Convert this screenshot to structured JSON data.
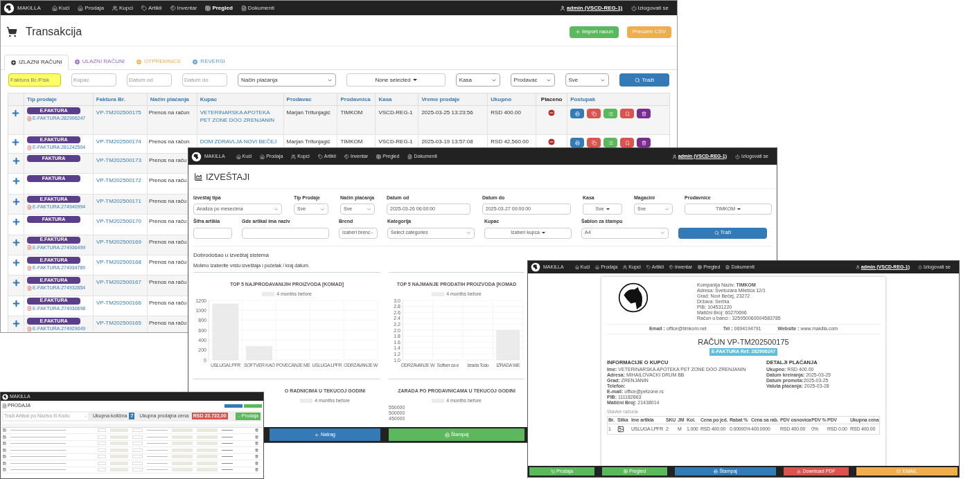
{
  "main_window": {
    "brand": "MAKILLA",
    "nav": [
      {
        "label": "Kući",
        "selected": false
      },
      {
        "label": "Prodaja",
        "selected": false
      },
      {
        "label": "Kupci",
        "selected": false
      },
      {
        "label": "Artikli",
        "selected": false
      },
      {
        "label": "Inventar",
        "selected": false
      },
      {
        "label": "Pregled",
        "selected": true
      },
      {
        "label": "Dokumenti",
        "selected": false
      }
    ],
    "user": "admin (VSCD-REG-1)",
    "logout": "Izlogovati se",
    "title": "Transakcija",
    "actions": [
      {
        "label": "Import racun",
        "kind": "success"
      },
      {
        "label": "Preuzmi CSV",
        "kind": "warning"
      }
    ],
    "tabs": [
      {
        "label": "IZLAZNI RAČUNI",
        "selected": true,
        "color": "#333333"
      },
      {
        "label": "ULAZNI RAČUNI",
        "selected": false,
        "color": "#8e6bbf"
      },
      {
        "label": "OTPREMNICE",
        "selected": false,
        "color": "#f0ad4e"
      },
      {
        "label": "REVERSI",
        "selected": false,
        "color": "#5b9bd5"
      }
    ],
    "filters": [
      {
        "kind": "input",
        "placeholder": "Faktura Br./Fisk",
        "highlighted": true
      },
      {
        "kind": "input",
        "placeholder": "Kupac",
        "highlighted": false
      },
      {
        "kind": "input",
        "placeholder": "Datum od",
        "highlighted": false
      },
      {
        "kind": "input",
        "placeholder": "Datum do",
        "highlighted": false
      },
      {
        "kind": "select",
        "value": "Način plaćanja"
      },
      {
        "kind": "dropdown",
        "value": "None selected"
      },
      {
        "kind": "select",
        "value": "Kasa"
      },
      {
        "kind": "select",
        "value": "Prodavac"
      },
      {
        "kind": "select",
        "value": "Sve"
      },
      {
        "kind": "button",
        "label": "Traži"
      }
    ],
    "table": {
      "columns": [
        "Tip prodaje",
        "Faktura Br.",
        "Način plaćanja",
        "Kupac",
        "Prodavac",
        "Prodavnica",
        "Kasa",
        "Vreme prodaje",
        "Ukupno",
        "Placeno",
        "Postupak"
      ],
      "rows": [
        {
          "tip": "E.FAKTURA",
          "efaktura": "E-FAKTURA:282906247",
          "faktura": "VP-TM202500175",
          "nacin": "Prenos na račun",
          "kupac": "VETERINARSKA APOTEKA PET ZONE DOO ZRENJANIN",
          "prodavac": "Marjan Trifunjagić",
          "prodavnica": "TIMKOM",
          "kasa": "VSCD-REG-1",
          "vreme": "2025-03-25 13:23:56",
          "ukupno": "RSD 400.00",
          "paid": false
        },
        {
          "tip": "E.FAKTURA",
          "efaktura": "E-FAKTURA:281242504",
          "faktura": "VP-TM202500174",
          "nacin": "Prenos na račun",
          "kupac": "DOM ZDRAVLJA NOVI BEČEJ",
          "prodavac": "Marjan Trifunjagić",
          "prodavnica": "TIMKOM",
          "kasa": "VSCD-REG-1",
          "vreme": "2025-03-19 13:57:08",
          "ukupno": "RSD 42,560.00",
          "paid": false
        },
        {
          "tip": "FAKTURA",
          "faktura": "VP-TM202500173",
          "nacin": "Prenos na raču"
        },
        {
          "tip": "FAKTURA",
          "faktura": "VP-TM202500172",
          "nacin": "Prenos na raču"
        },
        {
          "tip": "E.FAKTURA",
          "efaktura": "E-FAKTURA:274940994",
          "faktura": "VP-TM202500171",
          "nacin": "Prenos na raču"
        },
        {
          "tip": "FAKTURA",
          "faktura": "VP-TM202500170",
          "nacin": "Prenos na raču"
        },
        {
          "tip": "E.FAKTURA",
          "efaktura": "E-FAKTURA:274936499",
          "faktura": "VP-TM202500169",
          "nacin": "Prenos na raču"
        },
        {
          "tip": "E.FAKTURA",
          "efaktura": "E-FAKTURA:274934789",
          "faktura": "VP-TM202500168",
          "nacin": "Prenos na raču"
        },
        {
          "tip": "E.FAKTURA",
          "efaktura": "E-FAKTURA:274932854",
          "faktura": "VP-TM202500167",
          "nacin": "Prenos na raču"
        },
        {
          "tip": "E.FAKTURA",
          "efaktura": "E-FAKTURA:274930698",
          "faktura": "VP-TM202500166",
          "nacin": "Prenos na raču"
        },
        {
          "tip": "E.FAKTURA",
          "efaktura": "E-FAKTURA:274929049",
          "faktura": "VP-TM202500165",
          "nacin": "Prenos na raču"
        }
      ]
    }
  },
  "reports_window": {
    "brand": "MAKILLA",
    "nav": [
      {
        "label": "Kući",
        "selected": false
      },
      {
        "label": "Prodaja",
        "selected": false
      },
      {
        "label": "Kupci",
        "selected": false
      },
      {
        "label": "Artikli",
        "selected": false
      },
      {
        "label": "Inventar",
        "selected": false
      },
      {
        "label": "Pregled",
        "selected": false
      },
      {
        "label": "Dokumenti",
        "selected": false
      }
    ],
    "user": "admin (VSCD-REG-1)",
    "logout": "Izlogovati se",
    "title": "IZVEŠTAJI",
    "fields_row_1": [
      {
        "label": "Izveštaj tipa",
        "kind": "select",
        "value": "Analiza po mesecima"
      },
      {
        "label": "Tip Prodaje",
        "kind": "select",
        "value": "Sve"
      },
      {
        "label": "Način plaćanja",
        "kind": "select",
        "value": "Sve"
      },
      {
        "label": "Datum od",
        "kind": "input",
        "value": "2025-03-26 06:00:00"
      },
      {
        "label": "Datum do",
        "kind": "input",
        "value": "2025-03-27 00:00:00"
      },
      {
        "label": "Kasa",
        "kind": "dropdown",
        "value": "Sve"
      },
      {
        "label": "Magacini",
        "kind": "select",
        "value": "Sve"
      },
      {
        "label": "Prodavnice",
        "kind": "dropdown",
        "value": "TIMKOM"
      }
    ],
    "fields_row_2": [
      {
        "label": "Šifra artikla",
        "kind": "input"
      },
      {
        "label": "Gde artikal ima naziv",
        "kind": "input"
      },
      {
        "label": "Brend",
        "kind": "select",
        "value": "Izaberi brenc"
      },
      {
        "label": "Kategorija",
        "kind": "select",
        "value": "Select categories"
      },
      {
        "label": "Kupac",
        "kind": "dropdown",
        "value": "Izaberi kupca"
      },
      {
        "label": "Šablon za štampu",
        "kind": "select",
        "value": "A4"
      }
    ],
    "search_button": "Traži",
    "welcome": "Dobrodošao u izveštaj sistema",
    "instructions": "Molimo izaberite vrstu izveštaja i početak / kraj datum.",
    "charts": [
      {
        "chart_data": {
          "type": "bar",
          "title": "TOP 5 NAJPRODAVANIJIH PROIZVODA [KOMAD]",
          "categories": [
            "USLUGA LPFR",
            "SOFTVER KAO",
            "POVECANJE ME",
            "USLUGA LPFR",
            "ODRZAVANJE W"
          ],
          "series": [
            {
              "name": "4 months before",
              "color": "#ebebeb",
              "values": [
                1130,
                270,
                0,
                0,
                0
              ]
            }
          ],
          "ylim": [
            0,
            1200
          ],
          "yticks": [
            0,
            200,
            400,
            600,
            800,
            1000,
            1200
          ],
          "grid": true
        }
      },
      {
        "chart_data": {
          "type": "bar",
          "title": "TOP 5 NAJMANJE PRODATIH PROIZVODA [KOMAD",
          "categories": [
            "ODRZAVANJE W",
            "Softver za e",
            "Izrada Todo",
            "IZRADA WE"
          ],
          "series": [
            {
              "name": "4 months before",
              "color": "#ebebeb",
              "values": [
                1,
                1,
                1,
                2
              ]
            }
          ],
          "ylim": [
            1,
            3
          ],
          "yticks": [
            {
              "value": 1,
              "label": "1.0"
            },
            1.2,
            1.4,
            1.6,
            1.8,
            {
              "value": 2,
              "label": "2.0"
            },
            2.2,
            2.4,
            2.6,
            2.8,
            {
              "value": 3,
              "label": "3.0"
            }
          ],
          "grid": true
        }
      }
    ],
    "lower_charts": [
      {
        "title": "O RADNICIMA U TEKUCOJ GODINI",
        "legend": "4 months before"
      },
      {
        "title": "ZARADA PO PRODAVNICAMA U TEKUCOJ GODINI",
        "legend": "4 months before",
        "axis_labels": [
          "550000",
          "500000",
          "450000"
        ]
      }
    ],
    "footer": [
      {
        "label": "Natrag",
        "kind": "primary"
      },
      {
        "label": "Štampaj",
        "kind": "success"
      }
    ]
  },
  "invoice_window": {
    "brand": "MAKILLA",
    "nav": [
      {
        "label": "Kući",
        "selected": false
      },
      {
        "label": "Prodaja",
        "selected": false
      },
      {
        "label": "Kupci",
        "selected": false
      },
      {
        "label": "Artikli",
        "selected": false
      },
      {
        "label": "Inventar",
        "selected": false
      },
      {
        "label": "Pregled",
        "selected": false
      },
      {
        "label": "Dokumenti",
        "selected": false
      }
    ],
    "user": "admin (VSCD-REG-1)",
    "logout": "Izlogovati se",
    "company": [
      "Kompanija Naziv: **TIMKOM**",
      "Adresa: Svetozara Miletića 12/1",
      "Grad: Novi Bečej, 23272",
      "Država: Serbia",
      "PIB: 104531220",
      "Matični Broj: 60270696",
      "Račun u banci : 325950060004583785"
    ],
    "contacts": [
      "**Email :** office@timkom.net",
      "**Tel :** 0694194791",
      "**Website :** www.makilla.com"
    ],
    "title": "RAČUN VP-TM202500175",
    "ref_badge": "E-FAKTURA Ref: 282906247",
    "customer_heading": "INFORMACIJE O KUPCU",
    "customer": [
      "**Ime:** VETERINARSKA APOTEKA PET ZONE DOO ZRENJANIN",
      "**Adresa:** MIHAILOVACKI DRUM BB",
      "**Grad:** ZRENJANIN",
      "**Telefon:**",
      "**E-mail:** office@petzone.rs",
      "**PIB:** 111182863",
      "**Matični Broj:** 21438014"
    ],
    "payment_heading": "DETALJI PLAĆANJA",
    "payment": [
      "**Ukupno:** RSD 400.00",
      "**Datum kreiranja:** 2025-03-25",
      "**Datum prometa:**2025-03-25",
      "**Valuta plaćanja:** 2025-03-28"
    ],
    "items_caption": "Stavke računa",
    "columns": [
      "Br.",
      "Slika",
      "Ime artikla",
      "SKU",
      "JM",
      "Kol.",
      "Cena po jed.",
      "Rabat %",
      "Cena sa rab.",
      "PDV osnovica",
      "PDV %",
      "PDV",
      "Ukupna cena"
    ],
    "items": [
      {
        "br": "1",
        "name": "USLUGA LPFR",
        "sku": "2",
        "jm": "M",
        "kol": "1.000",
        "cena": "RSD 400.00",
        "rabat": "0.00000%",
        "cena_rab": "400.0000",
        "osnovica": "RSD 400.00",
        "pdv_pct": "0%",
        "pdv": "RSD 0.00",
        "ukupno": "RSD 400.00"
      }
    ],
    "footer": [
      {
        "label": "Prodaja",
        "kind": "success"
      },
      {
        "label": "Pregled",
        "kind": "success"
      },
      {
        "label": "Štampaj",
        "kind": "primary"
      },
      {
        "label": "Download PDF",
        "kind": "danger"
      },
      {
        "label": "EMAIL",
        "kind": "warning"
      }
    ]
  },
  "sales_window": {
    "brand": "MAKILLA",
    "title": "PRODAJA",
    "search_placeholder": "Traži Artikal po Nazivu ili Kodu",
    "quantity_label": "Ukupna količina",
    "quantity": "7",
    "total_label": "Ukupna prodajna cena:",
    "total": "RSD 23.722,00",
    "sell_button": "Prodaja"
  }
}
